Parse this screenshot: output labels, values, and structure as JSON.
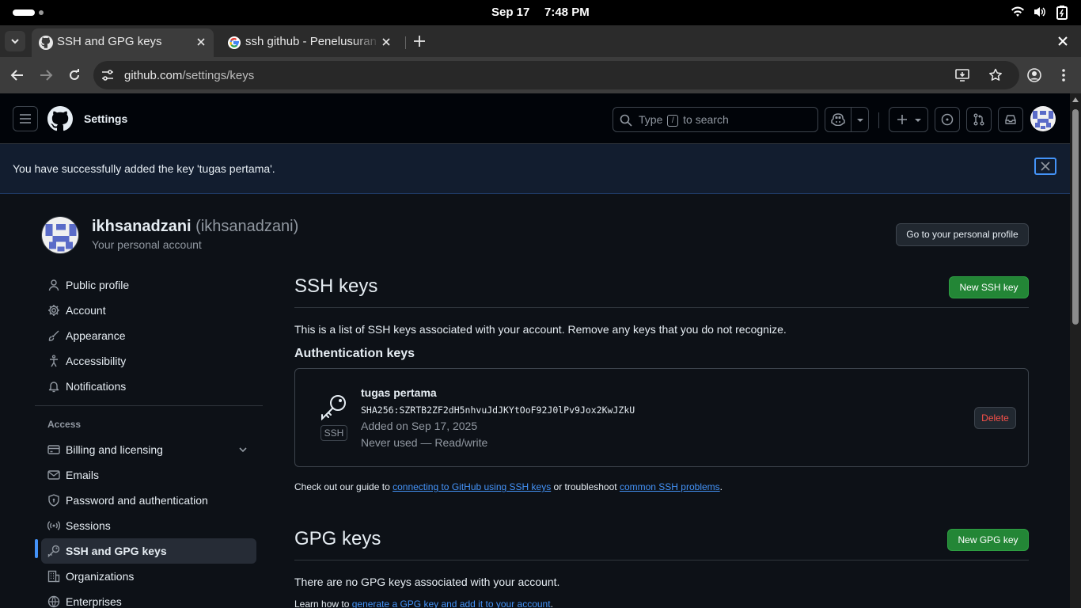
{
  "os": {
    "date": "Sep 17",
    "time": "7:48 PM"
  },
  "browser": {
    "tabs": [
      {
        "label": "SSH and GPG keys",
        "active": true
      },
      {
        "label": "ssh github - Penelusuran Google",
        "active": false
      }
    ],
    "url": {
      "host": "github.com",
      "path": "/settings/keys"
    }
  },
  "header": {
    "title": "Settings",
    "search_pre": "Type",
    "search_key": "/",
    "search_post": "to search"
  },
  "flash": {
    "message": "You have successfully added the key 'tugas pertama'."
  },
  "user": {
    "name": "ikhsanadzani",
    "login": "(ikhsanadzani)",
    "subtitle": "Your personal account",
    "profile_button": "Go to your personal profile"
  },
  "sidebar": {
    "items": [
      {
        "label": "Public profile"
      },
      {
        "label": "Account"
      },
      {
        "label": "Appearance"
      },
      {
        "label": "Accessibility"
      },
      {
        "label": "Notifications"
      }
    ],
    "access_heading": "Access",
    "access_items": [
      {
        "label": "Billing and licensing"
      },
      {
        "label": "Emails"
      },
      {
        "label": "Password and authentication"
      },
      {
        "label": "Sessions"
      },
      {
        "label": "SSH and GPG keys"
      },
      {
        "label": "Organizations"
      },
      {
        "label": "Enterprises"
      }
    ]
  },
  "ssh": {
    "title": "SSH keys",
    "new_button": "New SSH key",
    "description": "This is a list of SSH keys associated with your account. Remove any keys that you do not recognize.",
    "auth_heading": "Authentication keys",
    "key": {
      "badge": "SSH",
      "title": "tugas pertama",
      "fingerprint": "SHA256:SZRTB2ZF2dH5nhvuJdJKYtOoF92J0lPv9Jox2KwJZkU",
      "added": "Added on Sep 17, 2025",
      "usage": "Never used — Read/write",
      "delete": "Delete"
    },
    "guide_pre": "Check out our guide to",
    "guide_link": "connecting to GitHub using SSH keys",
    "guide_mid": "or troubleshoot",
    "guide_link2": "common SSH problems",
    "guide_post": "."
  },
  "gpg": {
    "title": "GPG keys",
    "new_button": "New GPG key",
    "empty": "There are no GPG keys associated with your account.",
    "learn_pre": "Learn how to",
    "learn_link": "generate a GPG key and add it to your account",
    "learn_post": "."
  },
  "colors": {
    "accent": "#4493f8",
    "primary": "#238636",
    "danger": "#f85149",
    "bg": "#0d1117"
  }
}
